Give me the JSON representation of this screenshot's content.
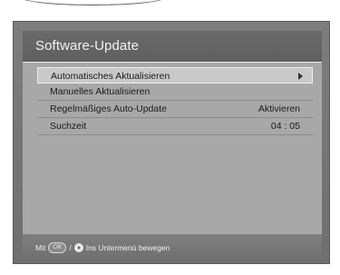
{
  "title": "Software-Update",
  "menu": [
    {
      "label": "Automatisches Aktualisieren",
      "value": "",
      "selected": true,
      "has_submenu": true
    },
    {
      "label": "Manuelles Aktualisieren",
      "value": "",
      "selected": false,
      "has_submenu": false
    },
    {
      "label": "Regelmäßiges Auto-Update",
      "value": "Aktivieren",
      "selected": false,
      "has_submenu": false
    },
    {
      "label": "Suchzeit",
      "value": "04 : 05",
      "selected": false,
      "has_submenu": false
    }
  ],
  "footer": {
    "prefix": "Mit",
    "ok_key": "OK",
    "separator": "/",
    "text": "Ins Untermenü bewegen"
  },
  "icons": {
    "submenu": "chevron-right-icon",
    "ok": "ok-button-icon",
    "right": "right-arrow-button-icon"
  }
}
